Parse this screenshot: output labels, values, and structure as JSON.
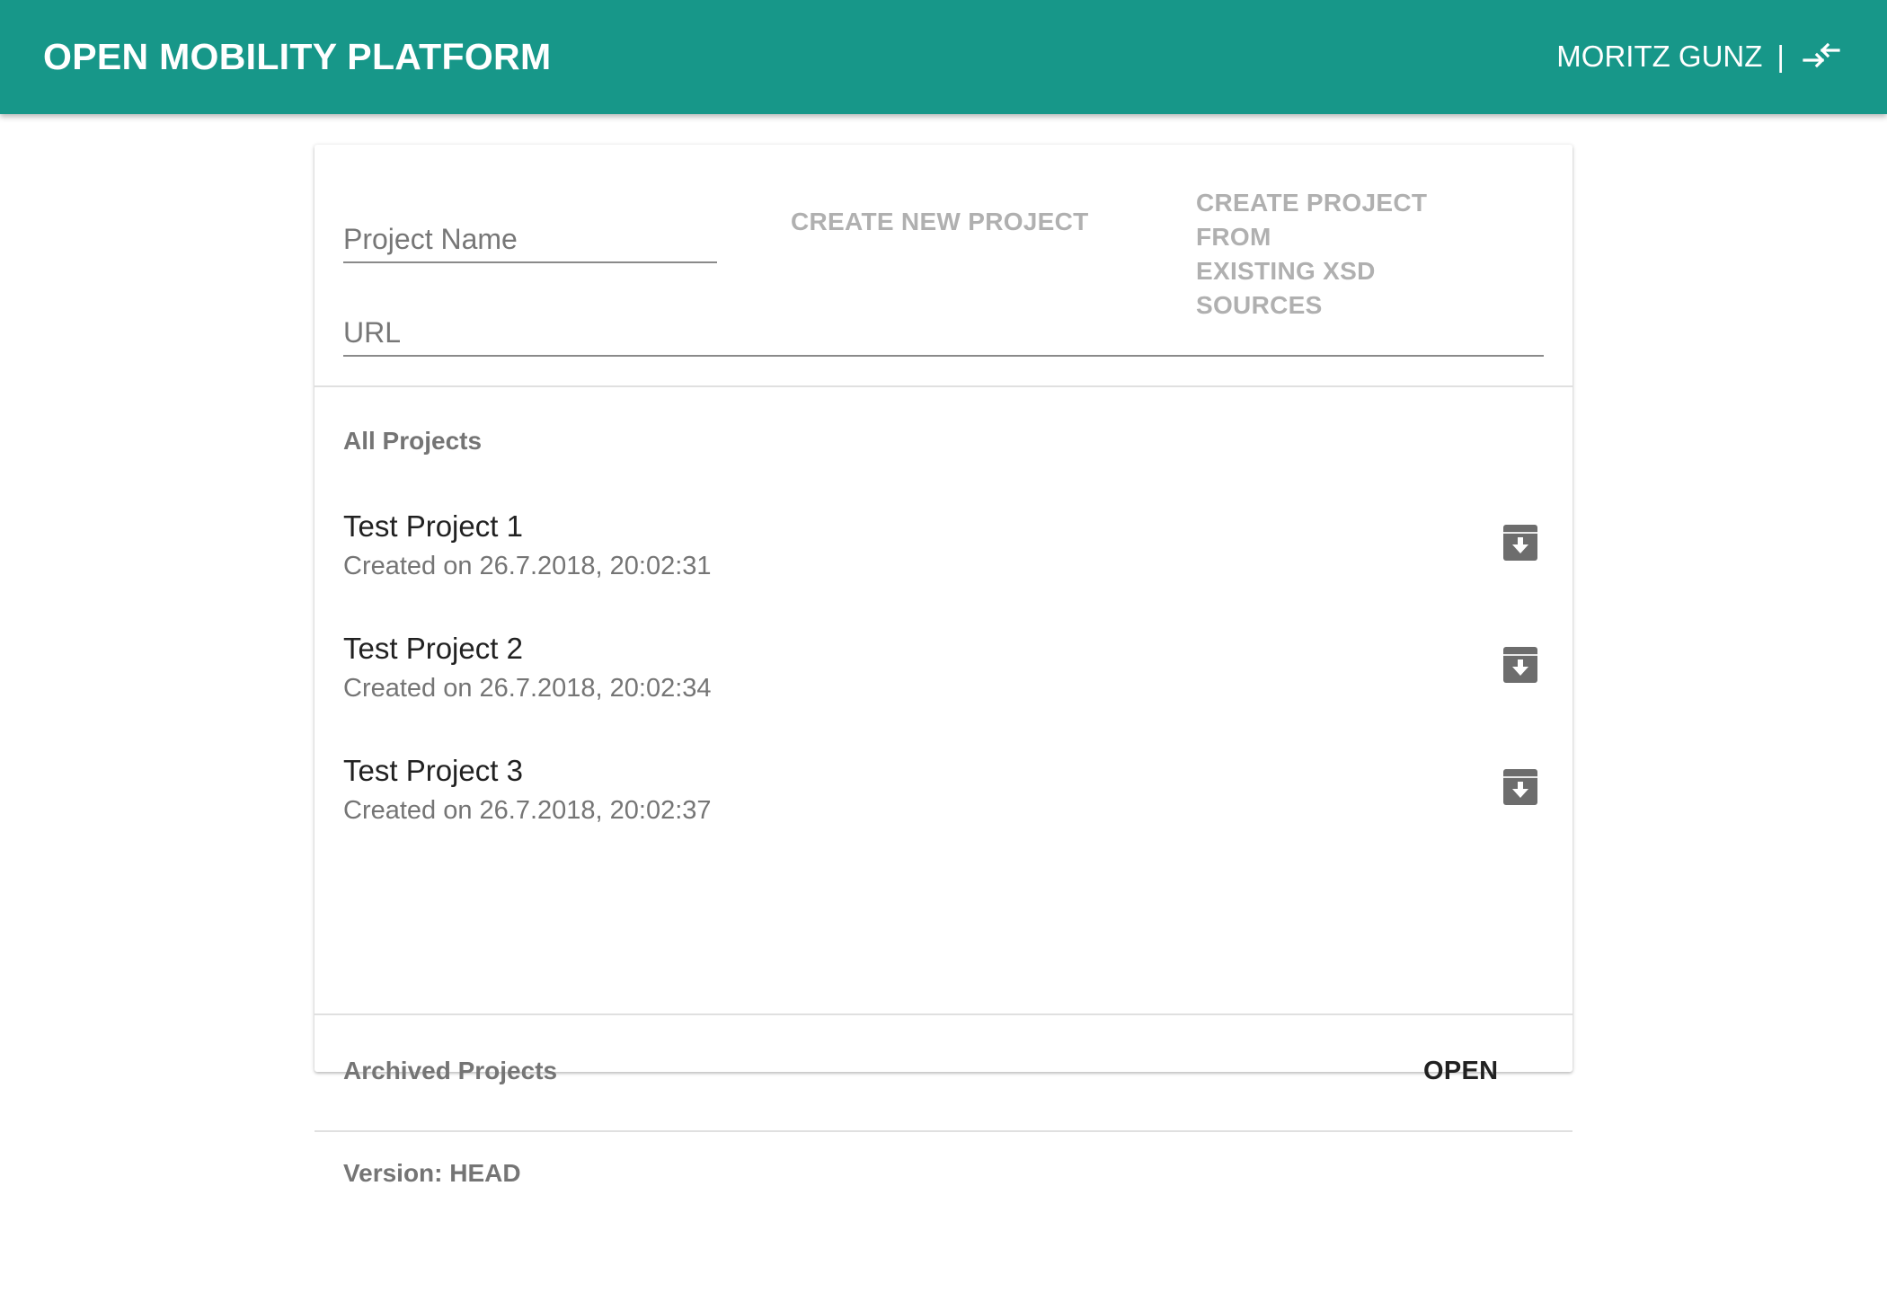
{
  "app": {
    "title": "OPEN MOBILITY PLATFORM",
    "user_name": "MORITZ GUNZ",
    "separator": "|",
    "logout_icon": "logout-arrows-icon",
    "accent_color": "#179789"
  },
  "create": {
    "project_name_placeholder": "Project Name",
    "url_placeholder": "URL",
    "create_new_label": "CREATE NEW PROJECT",
    "create_from_xsd_line1": "CREATE PROJECT FROM",
    "create_from_xsd_line2": "EXISTING XSD SOURCES"
  },
  "projects": {
    "heading": "All Projects",
    "items": [
      {
        "title": "Test Project 1",
        "created": "Created on 26.7.2018, 20:02:31",
        "action_icon": "archive-icon"
      },
      {
        "title": "Test Project 2",
        "created": "Created on 26.7.2018, 20:02:34",
        "action_icon": "archive-icon"
      },
      {
        "title": "Test Project 3",
        "created": "Created on 26.7.2018, 20:02:37",
        "action_icon": "archive-icon"
      }
    ]
  },
  "archived": {
    "heading": "Archived Projects",
    "open_label": "OPEN"
  },
  "footer": {
    "version": "Version: HEAD"
  }
}
